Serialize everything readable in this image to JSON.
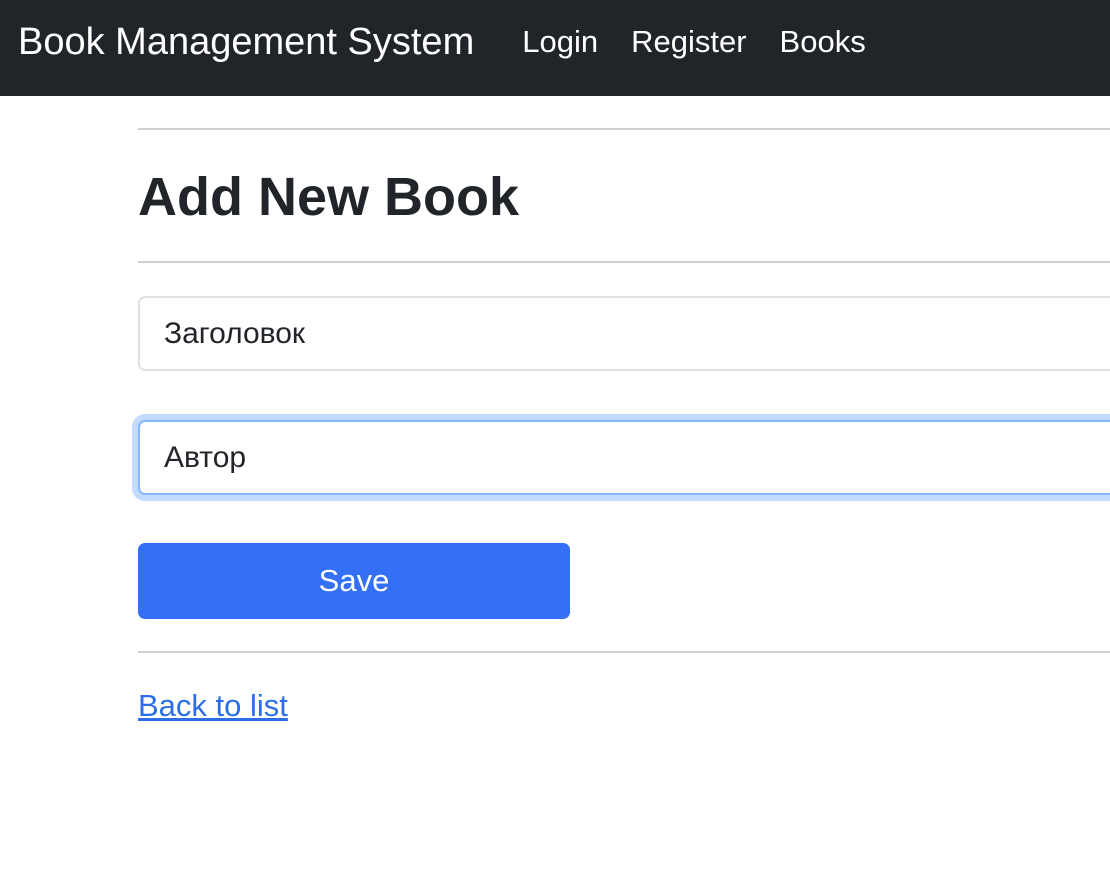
{
  "navbar": {
    "brand": "Book Management System",
    "links": [
      "Login",
      "Register",
      "Books"
    ],
    "background": "#212529"
  },
  "page": {
    "title": "Add New Book"
  },
  "form": {
    "title_placeholder": "Заголовок",
    "title_value": "",
    "author_placeholder": "Автор",
    "author_value": "",
    "save_label": "Save"
  },
  "back_link": "Back to list",
  "colors": {
    "primary": "#3370f5",
    "link": "#2d6ee6",
    "focus_ring": "#86b7fe"
  }
}
